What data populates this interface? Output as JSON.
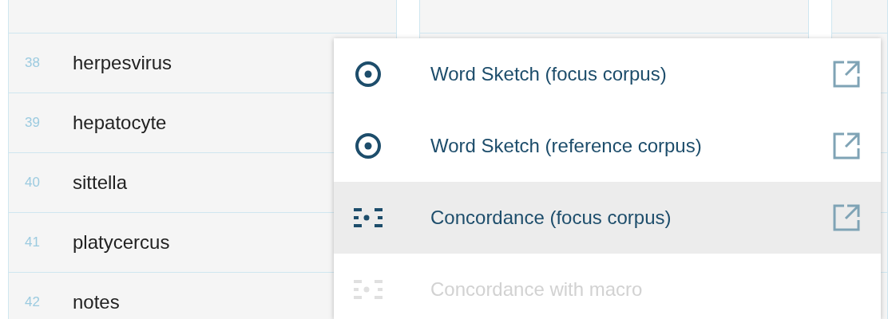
{
  "list_rows": [
    {
      "number": "38",
      "word": "herpesvirus"
    },
    {
      "number": "39",
      "word": "hepatocyte"
    },
    {
      "number": "40",
      "word": "sittella"
    },
    {
      "number": "41",
      "word": "platycercus"
    },
    {
      "number": "42",
      "word": "notes"
    }
  ],
  "context_menu": {
    "items": [
      {
        "label": "Word Sketch (focus corpus)",
        "kind": "sketch",
        "external_link": true,
        "selected": false,
        "disabled": false
      },
      {
        "label": "Word Sketch (reference corpus)",
        "kind": "sketch",
        "external_link": true,
        "selected": false,
        "disabled": false
      },
      {
        "label": "Concordance (focus corpus)",
        "kind": "concordance",
        "external_link": true,
        "selected": true,
        "disabled": false
      },
      {
        "label": "Concordance with macro",
        "kind": "concordance",
        "external_link": false,
        "selected": false,
        "disabled": true
      }
    ]
  }
}
